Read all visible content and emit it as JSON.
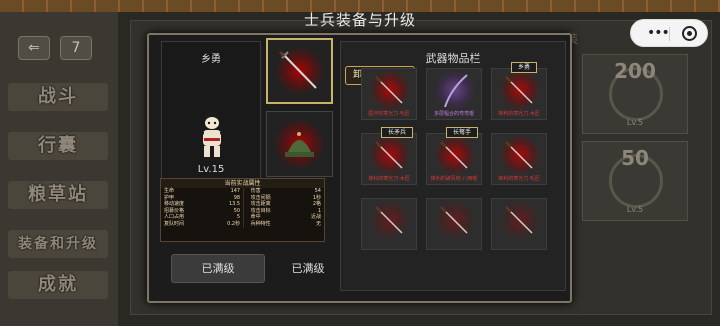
{
  "title": "士兵装备与升级",
  "background": {
    "menu": [
      "战斗",
      "行囊",
      "粮草站",
      "装备和升级",
      "成就"
    ],
    "tool_icons": [
      "back-icon",
      "calendar-icon"
    ],
    "calendar_day": "7",
    "tab_fragment": "装",
    "cards": [
      {
        "num": "200",
        "lv": "Lv.5"
      },
      {
        "num": "50",
        "lv": "Lv.5"
      }
    ]
  },
  "capsule": {
    "menu": "•••",
    "close": "target-icon"
  },
  "soldier": {
    "name": "乡勇",
    "level": "Lv.15",
    "stats_title": "当前实战属性",
    "stats": [
      [
        "生命",
        "147",
        "伤害",
        "54"
      ],
      [
        "护甲",
        "98",
        "攻击间隔",
        "1秒"
      ],
      [
        "移动速度",
        "13.5",
        "攻击距离",
        "2格"
      ],
      [
        "招募价格",
        "50",
        "攻击目标",
        "1"
      ],
      [
        "人口占用",
        "5",
        "命中",
        "近战"
      ],
      [
        "复队时间",
        "0.2秒",
        "兵种特性",
        "无"
      ]
    ]
  },
  "slots": [
    "weapon-slot",
    "helmet-slot"
  ],
  "actions": {
    "button": "已满级",
    "label": "已满级"
  },
  "inventory": {
    "title": "武器物品栏",
    "unequip": "卸下当前装备",
    "items": [
      {
        "name": "医疗的寒光刀·毛匠",
        "tag": "",
        "color": "red"
      },
      {
        "name": "多层幅合的弯弯棍",
        "tag": "",
        "color": "purple"
      },
      {
        "name": "锋利的寒光刀·木匠",
        "tag": "乡勇",
        "color": "red"
      },
      {
        "name": "锋利的寒光刀·木匠",
        "tag": "长矛兵",
        "color": "red"
      },
      {
        "name": "锋利的破风枪·八两棍",
        "tag": "长弩手",
        "color": "red"
      },
      {
        "name": "锋利的寒光刀·毛匠",
        "tag": "",
        "color": "red"
      },
      {
        "name": "",
        "tag": "",
        "color": "red"
      },
      {
        "name": "",
        "tag": "",
        "color": "red"
      },
      {
        "name": "",
        "tag": "",
        "color": "red"
      }
    ]
  },
  "colors": {
    "accent_gold": "#c9b36b",
    "item_red": "#d43a3a",
    "item_purple": "#c07ce6"
  }
}
